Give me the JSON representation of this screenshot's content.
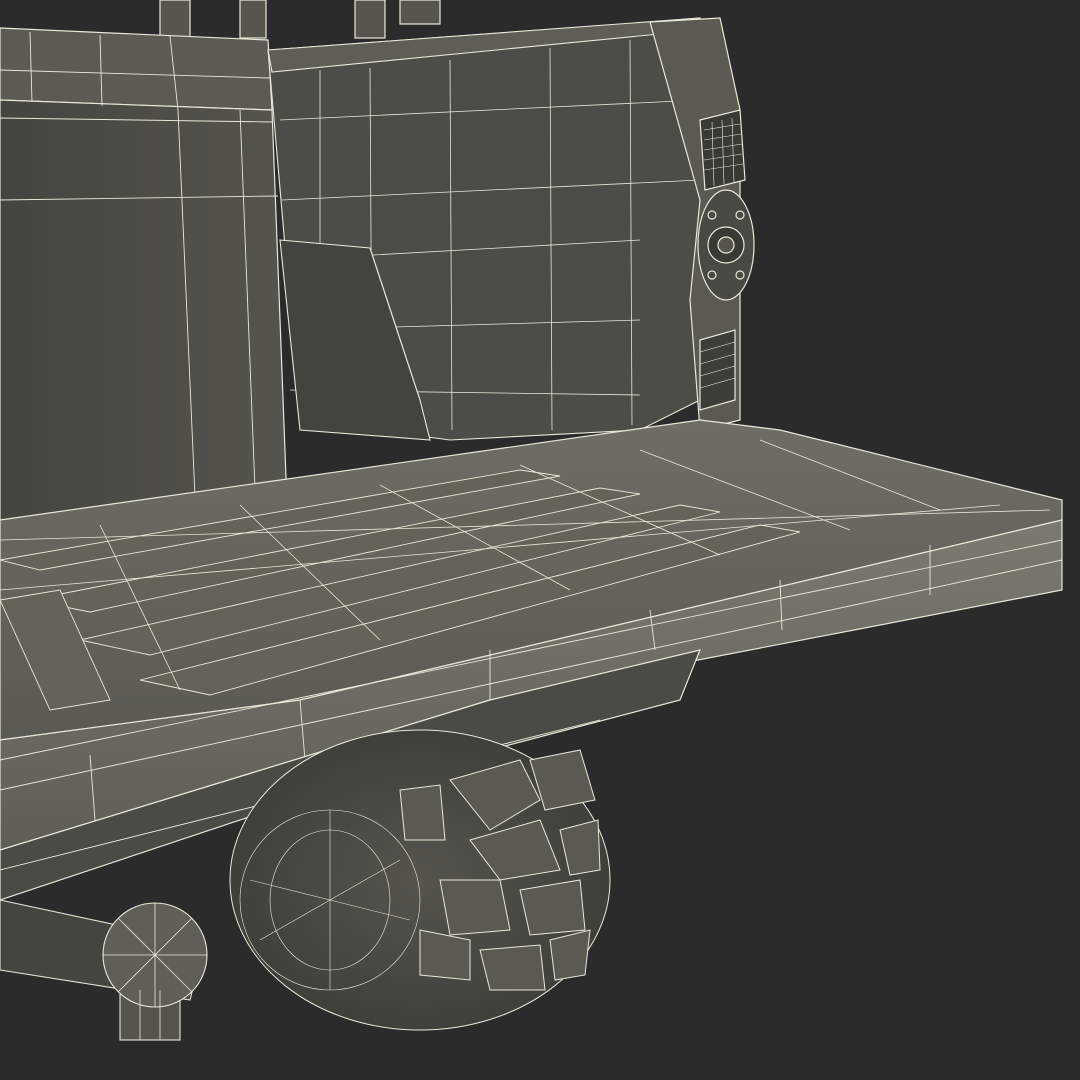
{
  "scene": {
    "subject": "wireframe-render",
    "colors": {
      "background": "#2b2b2b",
      "wire": "#e8e8d8",
      "surface_dark": "#4a4a44",
      "surface_mid": "#5c5c55",
      "surface_light": "#6b6b63",
      "shadow": "#34342f"
    }
  }
}
